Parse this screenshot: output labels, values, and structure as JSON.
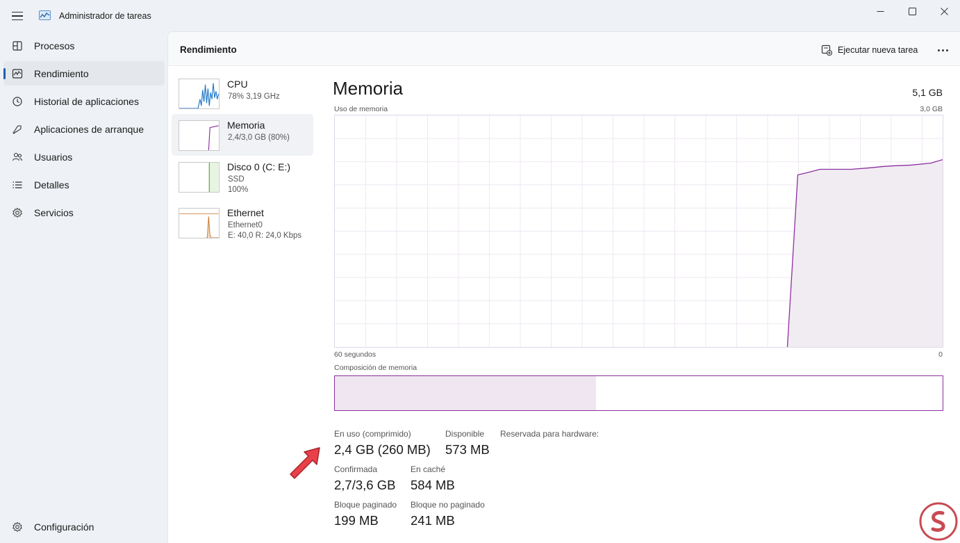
{
  "window": {
    "title": "Administrador de tareas",
    "controls": [
      "minimize-icon",
      "maximize-icon",
      "close-icon"
    ]
  },
  "sidebar": {
    "items": [
      {
        "label": "Procesos",
        "icon": "processes-icon"
      },
      {
        "label": "Rendimiento",
        "icon": "performance-icon",
        "active": true
      },
      {
        "label": "Historial de aplicaciones",
        "icon": "history-icon"
      },
      {
        "label": "Aplicaciones de arranque",
        "icon": "startup-icon"
      },
      {
        "label": "Usuarios",
        "icon": "users-icon"
      },
      {
        "label": "Detalles",
        "icon": "details-icon"
      },
      {
        "label": "Servicios",
        "icon": "services-icon"
      }
    ],
    "settings_label": "Configuración"
  },
  "header": {
    "title": "Rendimiento",
    "run_task_label": "Ejecutar nueva tarea"
  },
  "devices": [
    {
      "name": "CPU",
      "line1": "78% 3,19 GHz",
      "line2": "",
      "color": "#1f77c8"
    },
    {
      "name": "Memoria",
      "line1": "2,4/3,0 GB (80%)",
      "line2": "",
      "color": "#8b2fa0",
      "active": true
    },
    {
      "name": "Disco 0 (C: E:)",
      "line1": "SSD",
      "line2": "100%",
      "color": "#4daa2e"
    },
    {
      "name": "Ethernet",
      "line1": "Ethernet0",
      "line2": "E: 40,0 R: 24,0 Kbps",
      "color": "#c8742a"
    }
  ],
  "memory": {
    "title": "Memoria",
    "total": "5,1 GB",
    "usage_label": "Uso de memoria",
    "usage_max": "3,0 GB",
    "time_left": "60 segundos",
    "time_right": "0",
    "composition_label": "Composición de memoria",
    "composition_in_use_fraction": 0.43,
    "stats": {
      "in_use_label": "En uso (comprimido)",
      "in_use_value": "2,4 GB (260 MB)",
      "available_label": "Disponible",
      "available_value": "573 MB",
      "reserved_label": "Reservada para hardware:",
      "committed_label": "Confirmada",
      "committed_value": "2,7/3,6 GB",
      "cached_label": "En caché",
      "cached_value": "584 MB",
      "paged_label": "Bloque paginado",
      "paged_value": "199 MB",
      "nonpaged_label": "Bloque no paginado",
      "nonpaged_value": "241 MB"
    }
  },
  "colors": {
    "accent": "#1f5faa",
    "memory_line": "#8b2fa0",
    "memory_fill": "#efe6f1",
    "arrow": "#e8414a"
  }
}
